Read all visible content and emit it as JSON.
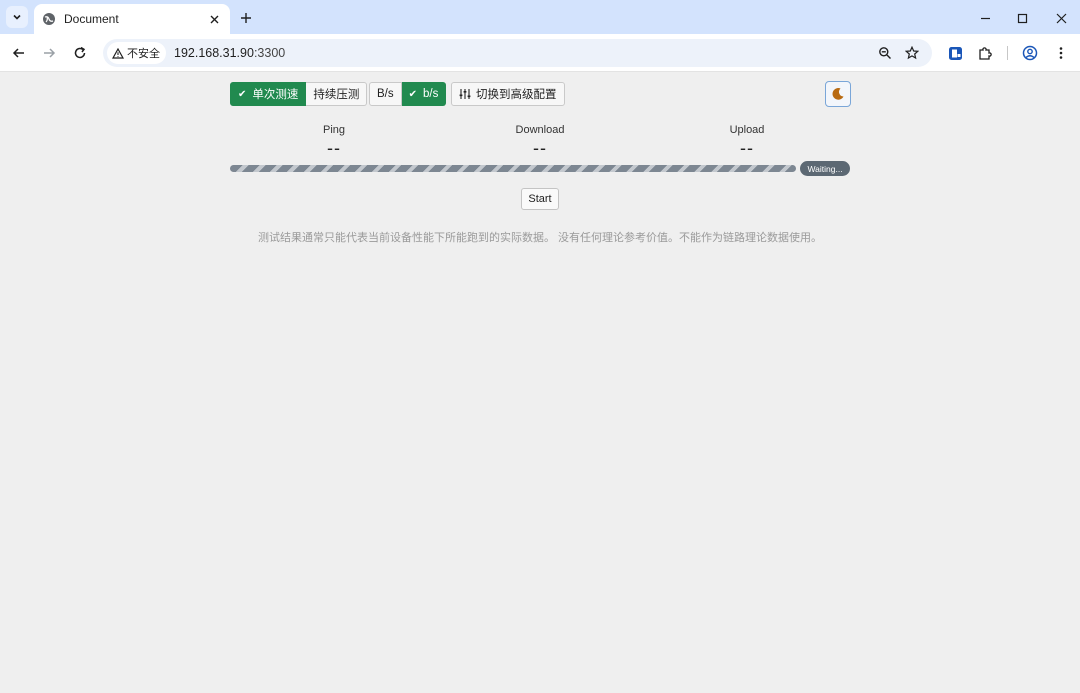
{
  "browser": {
    "tab_title": "Document",
    "security_label": "不安全",
    "url_host": "192.168.31.90",
    "url_port": ":3300"
  },
  "controls": {
    "mode_single": "单次测速",
    "mode_continuous": "持续压测",
    "unit_bytes": "B/s",
    "unit_bits": "b/s",
    "advanced": "切换到高级配置",
    "active_mode": "single",
    "active_unit": "bits"
  },
  "metrics": {
    "ping_label": "Ping",
    "ping_value": "--",
    "download_label": "Download",
    "download_value": "--",
    "upload_label": "Upload",
    "upload_value": "--"
  },
  "status": "Waiting...",
  "start_label": "Start",
  "disclaimer": "测试结果通常只能代表当前设备性能下所能跑到的实际数据。 没有任何理论参考价值。不能作为链路理论数据使用。",
  "colors": {
    "accent": "#218a4f",
    "badge": "#5c6873",
    "moon": "#b86a12"
  },
  "icons": {
    "tab_favicon": "globe-icon",
    "theme": "moon-icon",
    "advanced": "sliders-icon"
  }
}
